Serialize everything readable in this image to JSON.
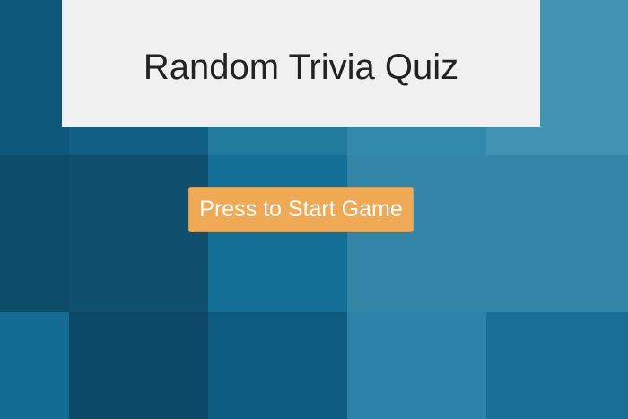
{
  "header": {
    "title": "Random Trivia Quiz"
  },
  "start_button": {
    "label": "Press to Start Game"
  },
  "colors": {
    "panel_background": "#f0f0f0",
    "title_text": "#222222",
    "button_background": "#f0a955",
    "button_text": "#ffffff",
    "background_mosaic": [
      [
        "#0d587a",
        "#115f85",
        "#1f7a9c",
        "#3089ab",
        "#4093b3"
      ],
      [
        "#0b4c69",
        "#0e506e",
        "#136f96",
        "#3386a7",
        "#3386a7"
      ],
      [
        "#136d93",
        "#0a4865",
        "#0e5b80",
        "#2c82a9",
        "#176f95"
      ]
    ]
  }
}
